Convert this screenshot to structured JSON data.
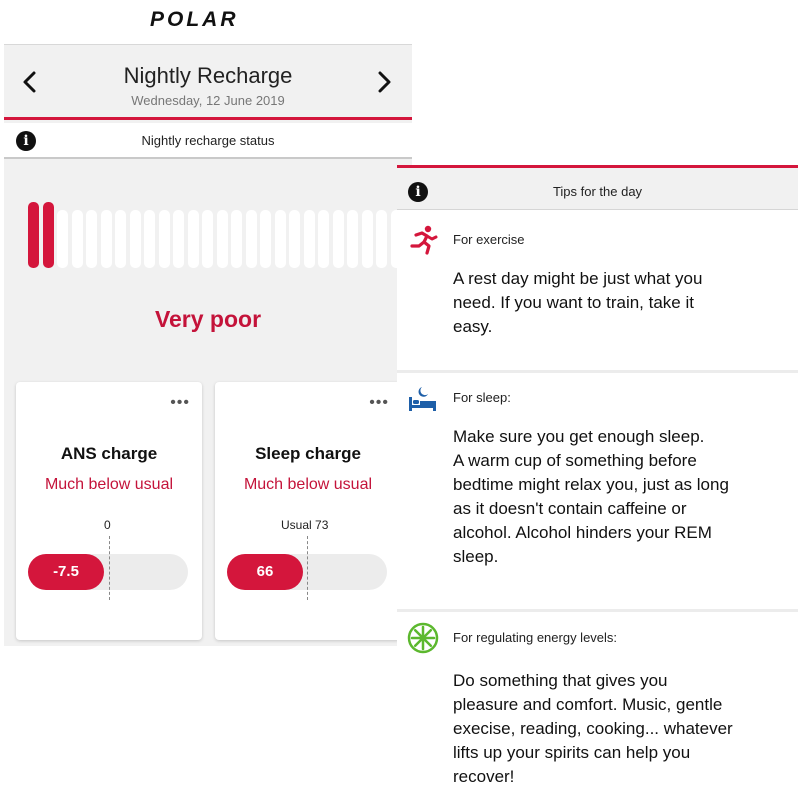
{
  "brand": {
    "logo_text": "POLAR",
    "accent_color": "#d4163c",
    "logo_icon": "polar-logo"
  },
  "left_screen": {
    "header": {
      "title": "Nightly Recharge",
      "date": "Wednesday, 12 June 2019",
      "prev_icon": "chevron-left-icon",
      "next_icon": "chevron-right-icon"
    },
    "status_bar": {
      "icon": "info-icon",
      "label": "Nightly recharge status"
    },
    "gauge": {
      "total_segments": 32,
      "filled_segments": 2,
      "filled_color": "#d4163c",
      "empty_color": "#ffffff"
    },
    "rating": "Very poor",
    "cards": [
      {
        "title": "ANS charge",
        "status": "Much below usual",
        "reference_label": "0",
        "value": "-7.5",
        "more_icon": "more-options-icon"
      },
      {
        "title": "Sleep charge",
        "status": "Much below usual",
        "reference_label": "Usual 73",
        "value": "66",
        "more_icon": "more-options-icon"
      }
    ]
  },
  "right_screen": {
    "header": {
      "icon": "info-icon",
      "label": "Tips for the day"
    },
    "tips": [
      {
        "icon": "running-person-icon",
        "icon_color": "#d4163c",
        "heading": "For exercise",
        "body_lines": [
          "A rest day might be just what you",
          "need. If you want to train, take it",
          "easy."
        ]
      },
      {
        "icon": "bed-sleep-icon",
        "icon_color": "#1e5fa8",
        "heading": "For sleep:",
        "body_lines": [
          "Make sure you get enough sleep.",
          "A warm cup of something before",
          "bedtime might relax you, just as long",
          "as it doesn't contain caffeine or",
          "alcohol. Alcohol hinders your REM",
          "sleep."
        ]
      },
      {
        "icon": "energy-burst-icon",
        "icon_color": "#5cb82e",
        "heading": "For regulating energy levels:",
        "body_lines": [
          "Do something that gives you",
          "pleasure and comfort. Music, gentle",
          "execise, reading, cooking... whatever",
          "lifts up your spirits can help you",
          "recover!"
        ]
      }
    ]
  }
}
